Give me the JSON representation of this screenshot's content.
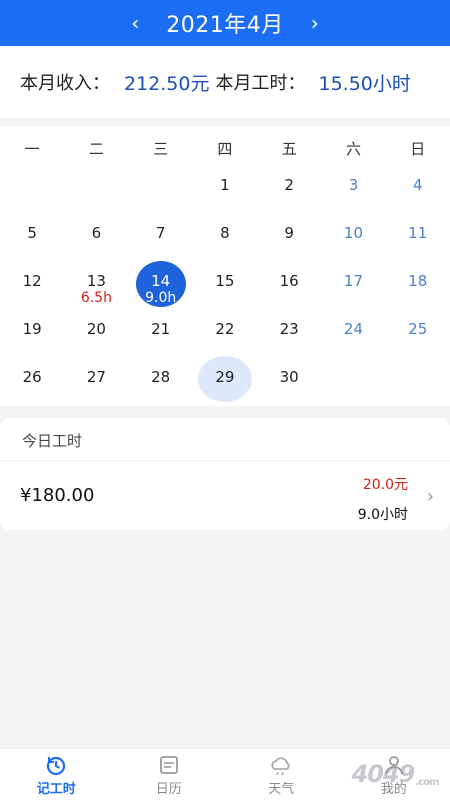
{
  "header": {
    "prev_label": "‹",
    "month_title": "2021年4月",
    "next_label": "›"
  },
  "summary": {
    "income_label": "本月收入：",
    "income_value": "212.50元",
    "hours_label": "本月工时：",
    "hours_value": "15.50小时"
  },
  "calendar": {
    "weekdays": [
      "一",
      "二",
      "三",
      "四",
      "五",
      "六",
      "日"
    ],
    "leading_blanks": 3,
    "days": [
      {
        "day": "1"
      },
      {
        "day": "2"
      },
      {
        "day": "3",
        "weekend": true
      },
      {
        "day": "4",
        "weekend": true
      },
      {
        "day": "5"
      },
      {
        "day": "6"
      },
      {
        "day": "7"
      },
      {
        "day": "8"
      },
      {
        "day": "9"
      },
      {
        "day": "10",
        "weekend": true
      },
      {
        "day": "11",
        "weekend": true
      },
      {
        "day": "12"
      },
      {
        "day": "13",
        "hours": "6.5h"
      },
      {
        "day": "14",
        "hours": "9.0h",
        "selected": true
      },
      {
        "day": "15"
      },
      {
        "day": "16"
      },
      {
        "day": "17",
        "weekend": true
      },
      {
        "day": "18",
        "weekend": true
      },
      {
        "day": "19"
      },
      {
        "day": "20"
      },
      {
        "day": "21"
      },
      {
        "day": "22"
      },
      {
        "day": "23"
      },
      {
        "day": "24",
        "weekend": true
      },
      {
        "day": "25",
        "weekend": true
      },
      {
        "day": "26"
      },
      {
        "day": "27"
      },
      {
        "day": "28"
      },
      {
        "day": "29",
        "today": true
      },
      {
        "day": "30"
      }
    ]
  },
  "today": {
    "label": "今日工时",
    "total": "¥180.00",
    "rate": "20.0元",
    "hours": "9.0小时"
  },
  "tabs": [
    {
      "label": "记工时",
      "icon": "clock-refresh-icon",
      "active": true
    },
    {
      "label": "日历",
      "icon": "calendar-icon",
      "active": false
    },
    {
      "label": "天气",
      "icon": "cloud-icon",
      "active": false
    },
    {
      "label": "我的",
      "icon": "user-icon",
      "active": false
    }
  ],
  "watermark": {
    "text": "4049",
    "suffix": ".com"
  },
  "colors": {
    "primary": "#1b6ef3",
    "accent_red": "#d3201c",
    "weekend_blue": "#4b82c9"
  }
}
